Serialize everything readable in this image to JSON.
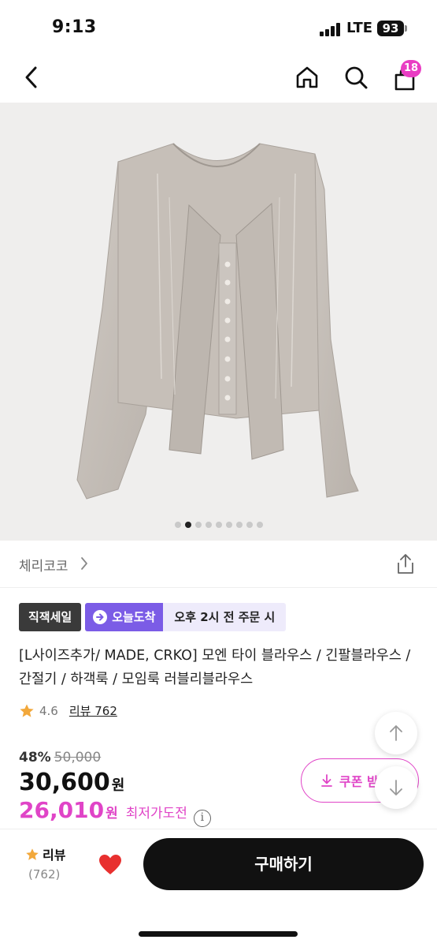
{
  "status": {
    "time": "9:13",
    "network": "LTE",
    "battery": "93"
  },
  "nav": {
    "cart_count": "18"
  },
  "gallery": {
    "total": 9,
    "active_index": 1
  },
  "brand": {
    "name": "체리코코"
  },
  "badges": {
    "sale": "직잭세일",
    "today": "오늘도착",
    "cutoff": "오후 2시 전 주문 시"
  },
  "product": {
    "title": "[L사이즈추가/ MADE, CRKO] 모엔 타이 블라우스 / 긴팔블라우스 / 간절기 / 하객룩 / 모임룩 러블리블라우스",
    "rating": "4.6",
    "review_link": "리뷰 762",
    "discount_rate": "48%",
    "original_price": "50,000",
    "price": "30,600",
    "currency": "원",
    "best_price": "26,010",
    "best_label": "최저가도전",
    "coupon_label": "쿠폰 받"
  },
  "bottom": {
    "review_label": "리뷰",
    "review_count": "(762)",
    "buy_label": "구매하기"
  },
  "colors": {
    "accent": "#e044c7",
    "today_badge": "#7b5ce6",
    "buy_button": "#111111"
  }
}
